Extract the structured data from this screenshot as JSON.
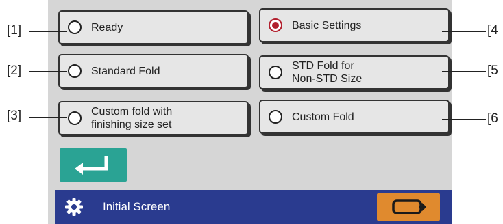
{
  "options": [
    {
      "label": "Ready",
      "selected": false
    },
    {
      "label": "Standard Fold",
      "selected": false
    },
    {
      "label": "Custom fold with\nfinishing size set",
      "selected": false
    },
    {
      "label": "Basic Settings",
      "selected": true
    },
    {
      "label": "STD Fold for\nNon-STD Size",
      "selected": false
    },
    {
      "label": "Custom Fold",
      "selected": false
    }
  ],
  "callouts": {
    "c1": "[1]",
    "c2": "[2]",
    "c3": "[3]",
    "c4": "[4",
    "c5": "[5",
    "c6": "[6"
  },
  "footer": {
    "title": "Initial Screen",
    "settings_icon": "gear-icon",
    "action_icon": "next-screen-icon"
  },
  "enter_button": {
    "icon": "enter-return-icon"
  },
  "colors": {
    "selected_radio": "#b2202e",
    "enter_button": "#2aa394",
    "footer_bar": "#2a3b8f",
    "orange_button": "#e08a2e"
  }
}
